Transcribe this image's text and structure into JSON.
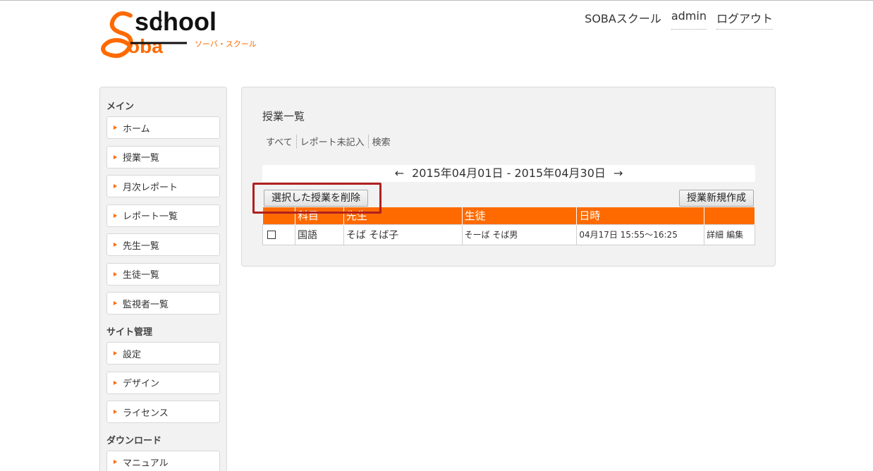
{
  "brand": {
    "logo_big": "school",
    "logo_sub": "ソーバ・スクール",
    "logo_word": "oba"
  },
  "header": {
    "site_name": "SOBAスクール",
    "user": "admin",
    "logout": "ログアウト"
  },
  "sidebar": {
    "sections": [
      {
        "heading": "メイン",
        "items": [
          "ホーム",
          "授業一覧",
          "月次レポート",
          "レポート一覧",
          "先生一覧",
          "生徒一覧",
          "監視者一覧"
        ]
      },
      {
        "heading": "サイト管理",
        "items": [
          "設定",
          "デザイン",
          "ライセンス"
        ]
      },
      {
        "heading": "ダウンロード",
        "items": [
          "マニュアル"
        ]
      }
    ]
  },
  "main": {
    "title": "授業一覧",
    "filters": [
      "すべて",
      "レポート未記入",
      "検索"
    ],
    "date_range": {
      "prev": "←",
      "text": "2015年04月01日 - 2015年04月30日",
      "next": "→"
    },
    "delete_button": "選択した授業を削除",
    "new_button": "授業新規作成",
    "table": {
      "headers": [
        "",
        "科目",
        "先生",
        "生徒",
        "日時",
        ""
      ],
      "rows": [
        {
          "subject": "国語",
          "teacher": "そば そば子",
          "student": "そーば そば男",
          "datetime": "04月17日 15:55～16:25",
          "detail": "詳細",
          "edit": "編集"
        }
      ]
    }
  },
  "colors": {
    "accent": "#ff6a00",
    "highlight": "#b02020"
  }
}
